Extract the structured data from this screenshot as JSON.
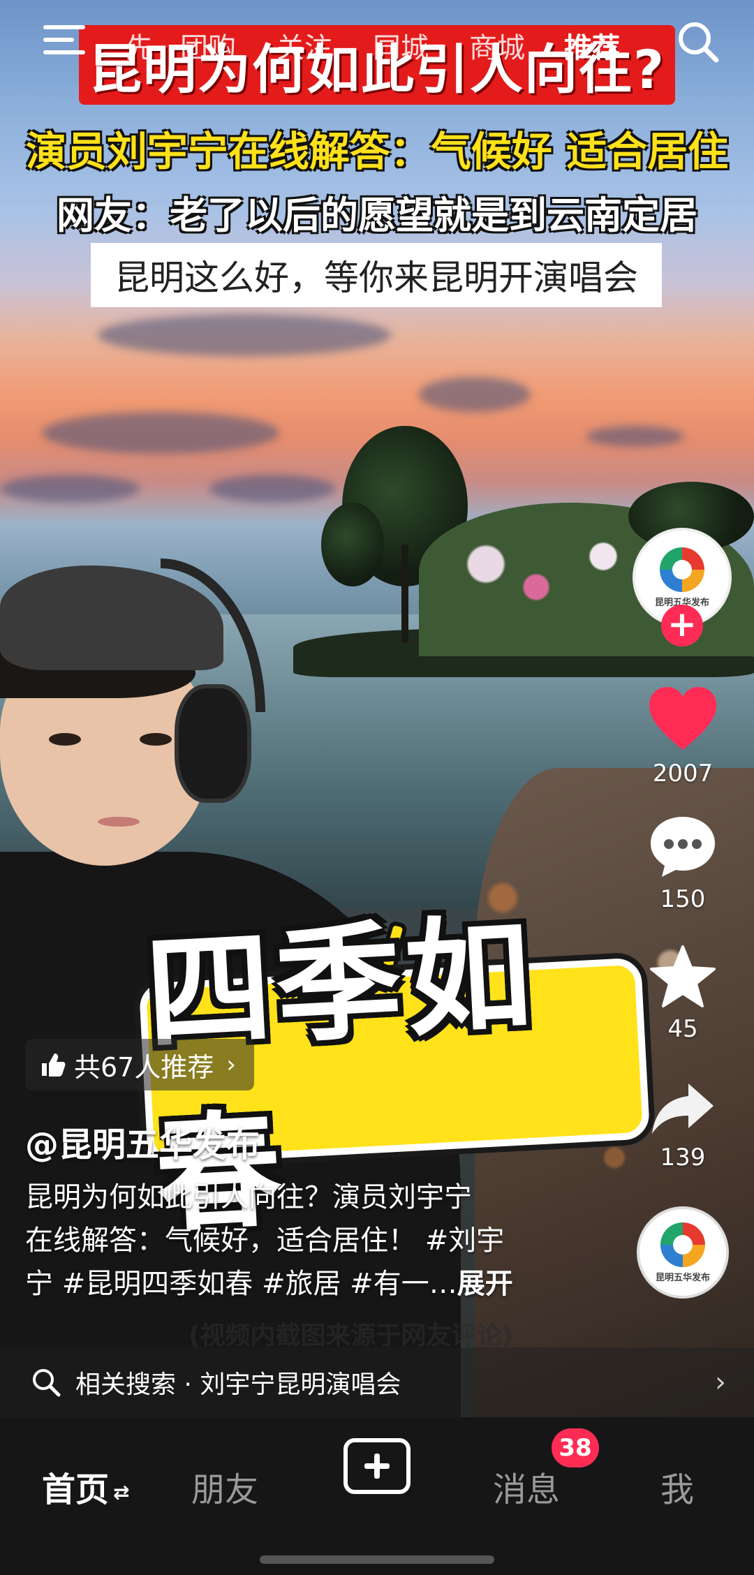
{
  "top_nav": {
    "tabs": [
      {
        "label": "先"
      },
      {
        "label": "团购"
      },
      {
        "label": "关注"
      },
      {
        "label": "同城"
      },
      {
        "label": "商城"
      },
      {
        "label": "推荐"
      }
    ],
    "active_tab": "推荐"
  },
  "video_captions": {
    "headline": "昆明为何如此引人向往?",
    "subline": "演员刘宇宁在线解答：气候好 适合居住",
    "comment": "网友：老了以后的愿望就是到云南定居",
    "boxed": "昆明这么好，等你来昆明开演唱会",
    "sticker": "四季如春",
    "source_note": "(视频内截图来源于网友评论)"
  },
  "actions": {
    "author_logo_text": "昆明五华发布",
    "likes": "2007",
    "comments": "150",
    "favorites": "45",
    "shares": "139",
    "follow_symbol": "+"
  },
  "post": {
    "recommend": "共67人推荐",
    "author": "@昆明五华发布",
    "description_lines": [
      "昆明为何如此引人向往？演员刘宇宁",
      "在线解答：气候好，适合居住！ #刘宇",
      "宁 #昆明四季如春 #旅居 #有一…"
    ],
    "expand": "展开"
  },
  "related_search": {
    "text": "相关搜索 · 刘宇宁昆明演唱会"
  },
  "bottom_tabs": {
    "home": "首页",
    "friends": "朋友",
    "messages": "消息",
    "me": "我",
    "messages_badge": "38"
  },
  "colors": {
    "accent": "#fe2c55",
    "caption_red": "#e41b1b",
    "caption_yellow": "#ffe11a",
    "tabbar_bg": "#161616"
  },
  "icons": [
    "menu-icon",
    "search-icon",
    "heart-icon",
    "comment-icon",
    "star-icon",
    "share-icon",
    "thumbs-up-icon",
    "plus-icon"
  ]
}
